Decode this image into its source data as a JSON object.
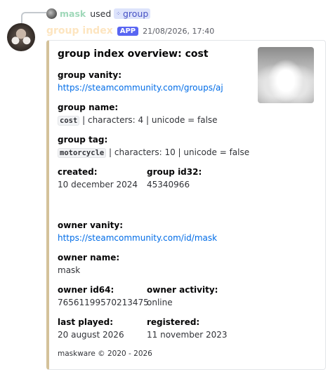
{
  "reply": {
    "user": "mask",
    "used_text": "used",
    "command": "group"
  },
  "message": {
    "author": "group index",
    "badge": "APP",
    "timestamp": "21/08/2026, 17:40"
  },
  "embed": {
    "title": "group index overview: cost",
    "accent_color": "#d4c29a",
    "fields": {
      "vanity": {
        "name": "group vanity:",
        "value": "https://steamcommunity.com/groups/aj"
      },
      "group_name": {
        "name": "group name:",
        "code": "cost",
        "rest": " | characters: 4 | unicode = false"
      },
      "group_tag": {
        "name": "group tag:",
        "code": "motorcycle",
        "rest": " | characters: 10 | unicode = false"
      },
      "created": {
        "name": "created:",
        "value": "10 december 2024"
      },
      "group_id32": {
        "name": "group id32:",
        "value": "45340966"
      },
      "owner_vanity": {
        "name": "owner vanity:",
        "value": "https://steamcommunity.com/id/mask"
      },
      "owner_name": {
        "name": "owner name:",
        "value": "mask"
      },
      "owner_id64": {
        "name": "owner id64:",
        "value": "76561199570213475"
      },
      "owner_activity": {
        "name": "owner activity:",
        "value": "online"
      },
      "last_played": {
        "name": "last played:",
        "value": "20 august 2026"
      },
      "registered": {
        "name": "registered:",
        "value": "11 november 2023"
      }
    },
    "footer": "maskware © 2020 - 2026"
  }
}
